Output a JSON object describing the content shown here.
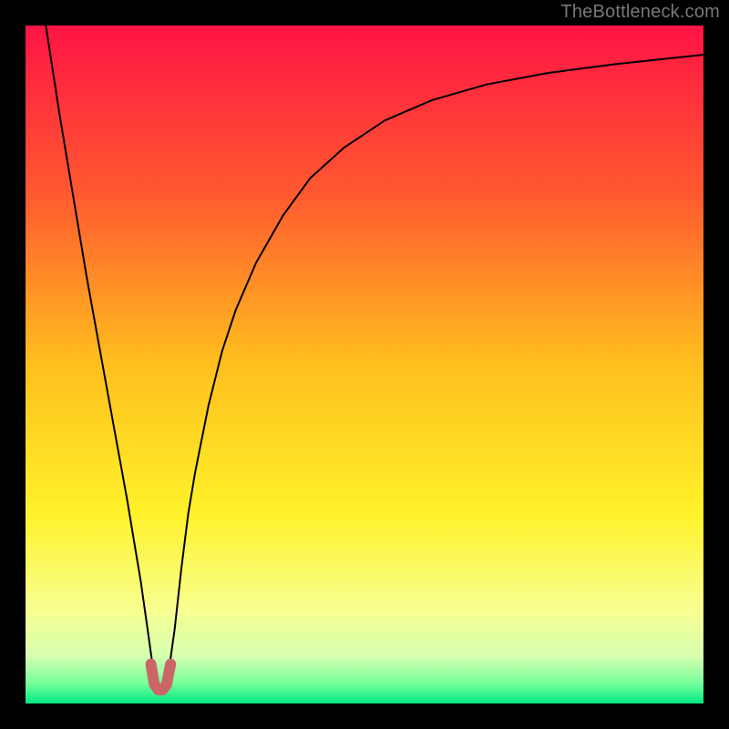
{
  "watermark": "TheBottleneck.com",
  "chart_data": {
    "type": "line",
    "title": "",
    "xlabel": "",
    "ylabel": "",
    "xlim": [
      0,
      100
    ],
    "ylim": [
      0,
      100
    ],
    "background": {
      "type": "vertical-gradient",
      "stops": [
        {
          "pos": 0.0,
          "color": "#ff1445"
        },
        {
          "pos": 0.25,
          "color": "#ff5a2f"
        },
        {
          "pos": 0.5,
          "color": "#ffbf1e"
        },
        {
          "pos": 0.72,
          "color": "#fff22a"
        },
        {
          "pos": 0.86,
          "color": "#f8ff8f"
        },
        {
          "pos": 0.93,
          "color": "#d7ffb0"
        },
        {
          "pos": 0.97,
          "color": "#77ff9a"
        },
        {
          "pos": 1.0,
          "color": "#00e884"
        }
      ]
    },
    "series": [
      {
        "name": "bottleneck-curve",
        "stroke": "#000000",
        "stroke_width": 2,
        "x": [
          3.0,
          5.0,
          7.0,
          9.0,
          11.0,
          13.0,
          15.0,
          16.0,
          17.0,
          18.0,
          18.7,
          19.3,
          20.0,
          20.7,
          21.3,
          22.0,
          23.0,
          24.0,
          25.0,
          27.0,
          29.0,
          31.0,
          34.0,
          38.0,
          42.0,
          47.0,
          53.0,
          60.0,
          68.0,
          77.0,
          87.0,
          100.0
        ],
        "y": [
          100.0,
          87.0,
          75.0,
          63.0,
          52.0,
          41.0,
          30.0,
          24.0,
          18.0,
          11.0,
          6.0,
          3.0,
          2.0,
          3.0,
          6.0,
          11.0,
          20.0,
          28.0,
          34.0,
          44.0,
          52.0,
          58.0,
          65.0,
          72.0,
          77.5,
          82.0,
          86.0,
          89.0,
          91.3,
          93.0,
          94.3,
          95.7
        ]
      },
      {
        "name": "highlight-dip",
        "stroke": "#cc6666",
        "stroke_width": 12,
        "linecap": "round",
        "x": [
          18.5,
          19.0,
          19.6,
          20.2,
          20.8,
          21.4
        ],
        "y": [
          5.8,
          2.8,
          2.0,
          2.0,
          2.8,
          5.8
        ]
      }
    ]
  }
}
